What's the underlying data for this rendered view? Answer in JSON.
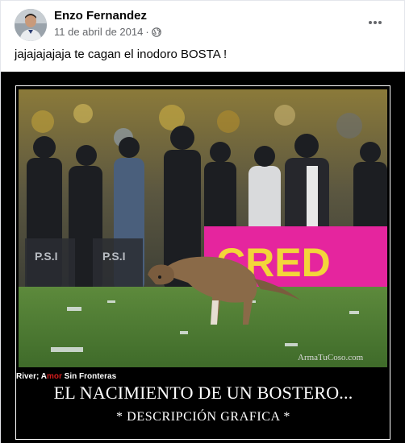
{
  "post": {
    "author_name": "Enzo Fernandez",
    "timestamp": "11 de abril de 2014",
    "separator": "·",
    "audience_icon": "globe-icon",
    "more_icon": "more-horizontal-icon",
    "caption": "jajajajajaja te cagan el inodoro BOSTA !"
  },
  "meme": {
    "credit_prefix": "River; A",
    "credit_red": "mor",
    "credit_suffix": " Sin Fronteras",
    "watermark": "ArmaTuCoso.com",
    "billboard_text": "CRED",
    "headline": "EL NACIMIENTO DE UN BOSTERO...",
    "subline": "* DESCRIPCIÓN GRAFICA *"
  },
  "colors": {
    "secondary_text": "#65676b",
    "primary_text": "#050505",
    "billboard": "#e5259e",
    "pitch": "#4f7a33"
  }
}
